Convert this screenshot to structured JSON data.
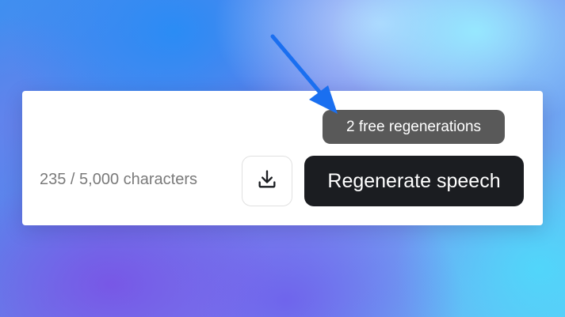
{
  "tooltip": {
    "text": "2 free regenerations"
  },
  "editor": {
    "char_count": "235 / 5,000 characters"
  },
  "actions": {
    "download_icon": "download-icon",
    "regenerate_label": "Regenerate speech"
  },
  "annotation": {
    "arrow_color": "#1a6ff0"
  },
  "colors": {
    "primary_button": "#1b1d21",
    "tooltip_bg": "#595959",
    "muted_text": "#7a7a7a"
  }
}
